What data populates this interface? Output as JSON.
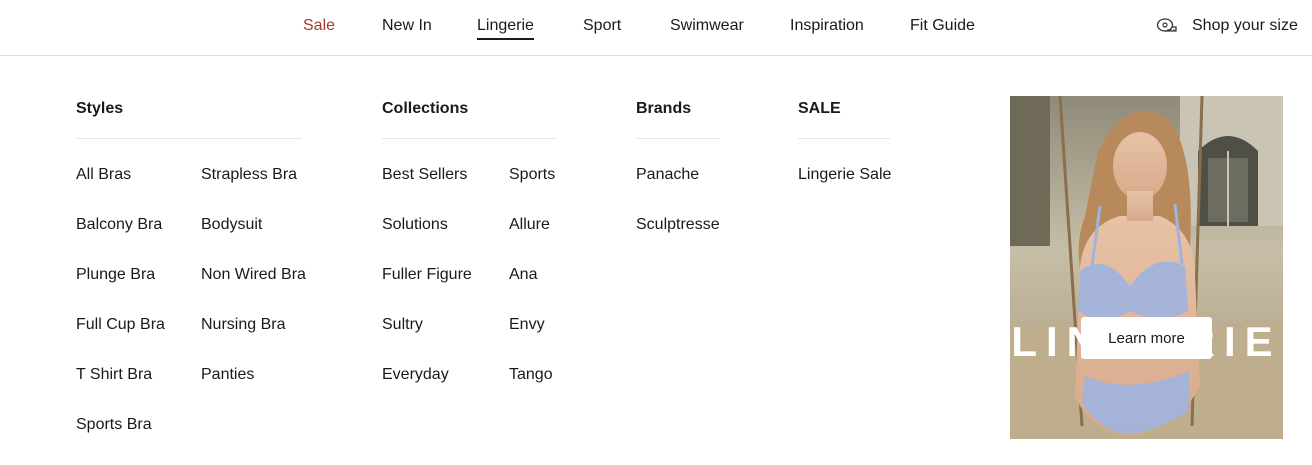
{
  "nav": {
    "items": [
      {
        "label": "Sale"
      },
      {
        "label": "New In"
      },
      {
        "label": "Lingerie"
      },
      {
        "label": "Sport"
      },
      {
        "label": "Swimwear"
      },
      {
        "label": "Inspiration"
      },
      {
        "label": "Fit Guide"
      }
    ],
    "shop_size": {
      "label": "Shop your size",
      "icon": "tape-measure-icon"
    },
    "active": "Lingerie"
  },
  "menu": {
    "styles": {
      "title": "Styles",
      "items": [
        "All Bras",
        "Strapless Bra",
        "Balcony Bra",
        "Bodysuit",
        "Plunge Bra",
        "Non Wired Bra",
        "Full Cup Bra",
        "Nursing Bra",
        "T Shirt Bra",
        "Panties",
        "Sports Bra"
      ]
    },
    "collections": {
      "title": "Collections",
      "items": [
        "Best Sellers",
        "Sports",
        "Solutions",
        "Allure",
        "Fuller Figure",
        "Ana",
        "Sultry",
        "Envy",
        "Everyday",
        "Tango"
      ]
    },
    "brands": {
      "title": "Brands",
      "items": [
        "Panache",
        "Sculptresse"
      ]
    },
    "sale": {
      "title": "SALE",
      "items": [
        "Lingerie Sale"
      ]
    }
  },
  "promo": {
    "title": "LINGERIE",
    "button_label": "Learn more"
  },
  "colors": {
    "sale_accent": "#a8392b",
    "text": "#1a1a1a",
    "divider": "#e6e6e6"
  }
}
